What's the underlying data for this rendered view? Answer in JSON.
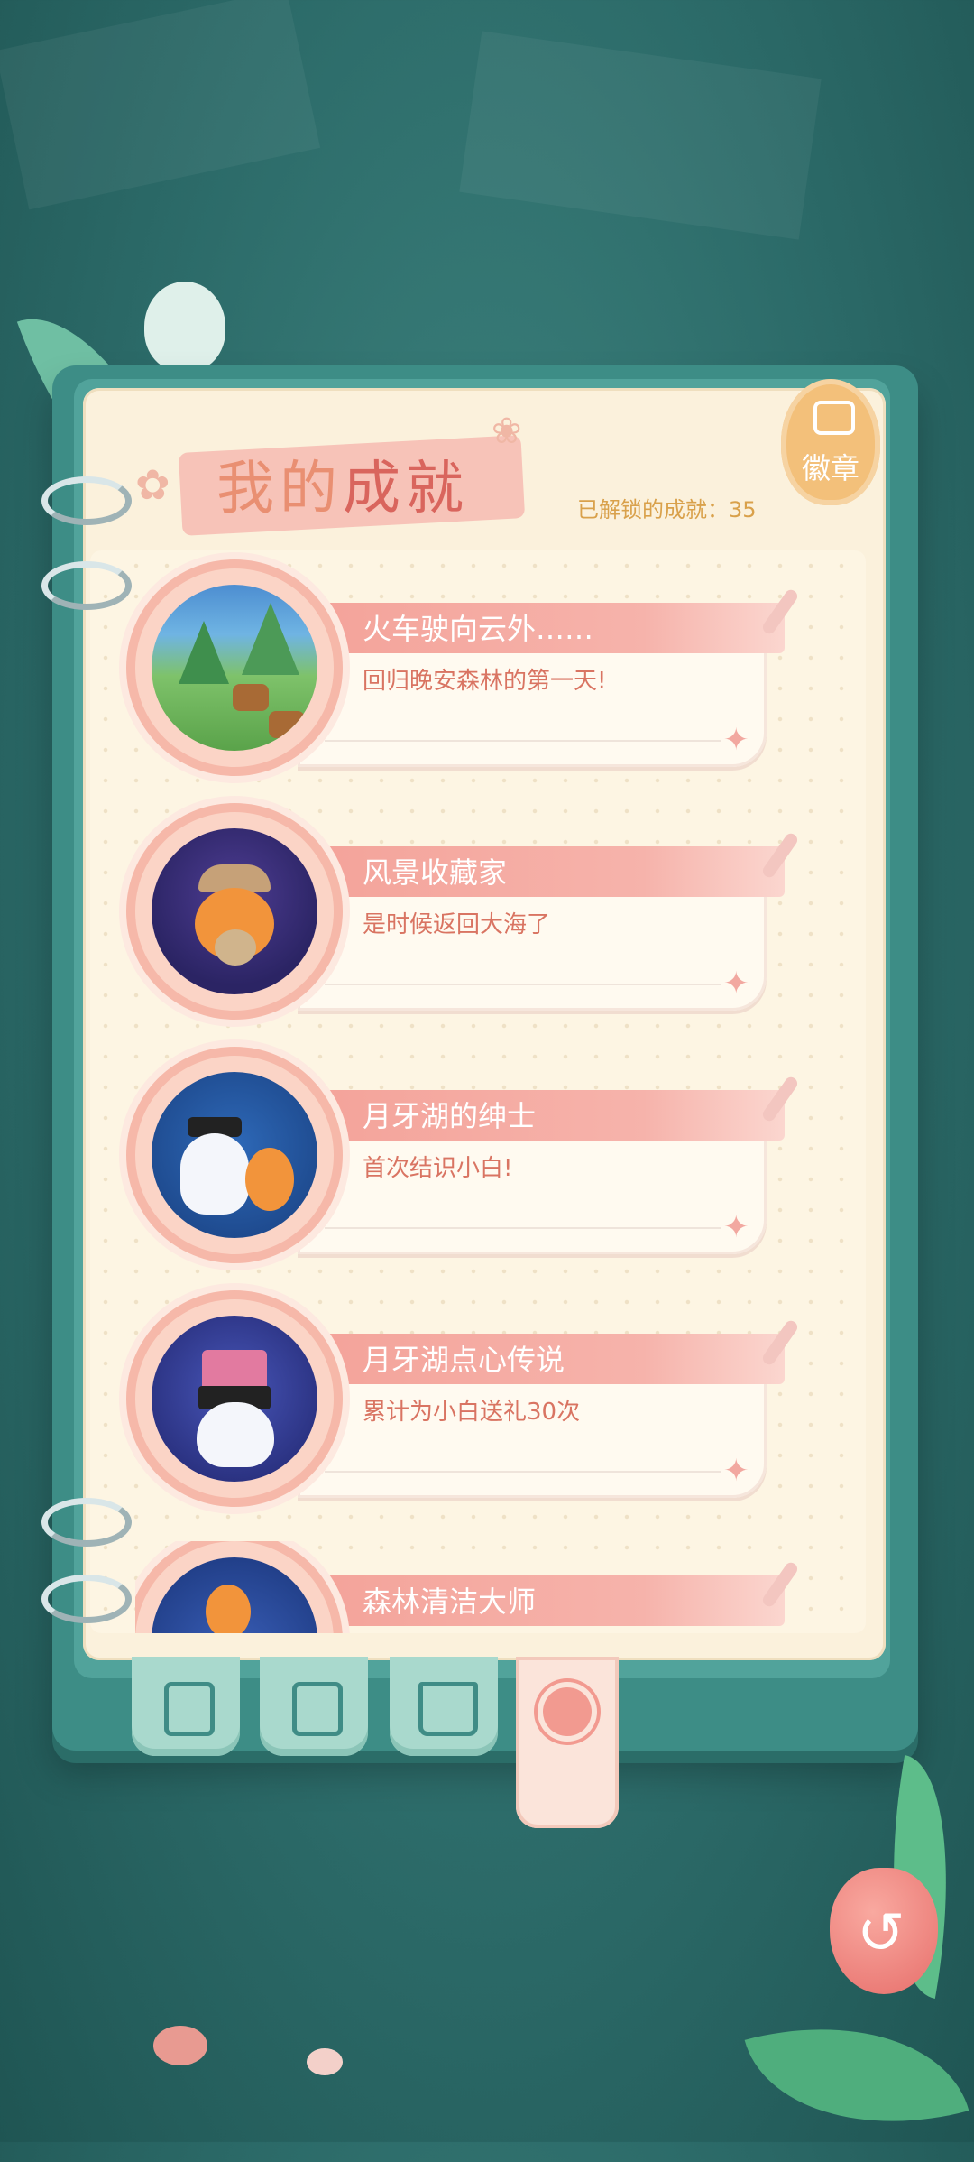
{
  "page": {
    "title_part1": "我的",
    "title_part2": "成就",
    "unlocked_label": "已解锁的成就：35",
    "badge_tab_label": "徽章"
  },
  "achievements": [
    {
      "name": "火车驶向云外……",
      "desc": "回归晚安森林的第一天!"
    },
    {
      "name": "风景收藏家",
      "desc": "是时候返回大海了"
    },
    {
      "name": "月牙湖的绅士",
      "desc": "首次结识小白!"
    },
    {
      "name": "月牙湖点心传说",
      "desc": "累计为小白送礼30次"
    },
    {
      "name": "森林清洁大师",
      "desc": ""
    }
  ],
  "tabs": [
    {
      "icon": "notes-icon"
    },
    {
      "icon": "photo-journal-icon"
    },
    {
      "icon": "open-book-icon"
    },
    {
      "icon": "flower-medal-icon",
      "active": true
    }
  ],
  "colors": {
    "background": "#2c6b69",
    "book": "#3d8d86",
    "page": "#fbf1dc",
    "ribbon": "#f4a39a",
    "accent": "#d9a14b"
  }
}
